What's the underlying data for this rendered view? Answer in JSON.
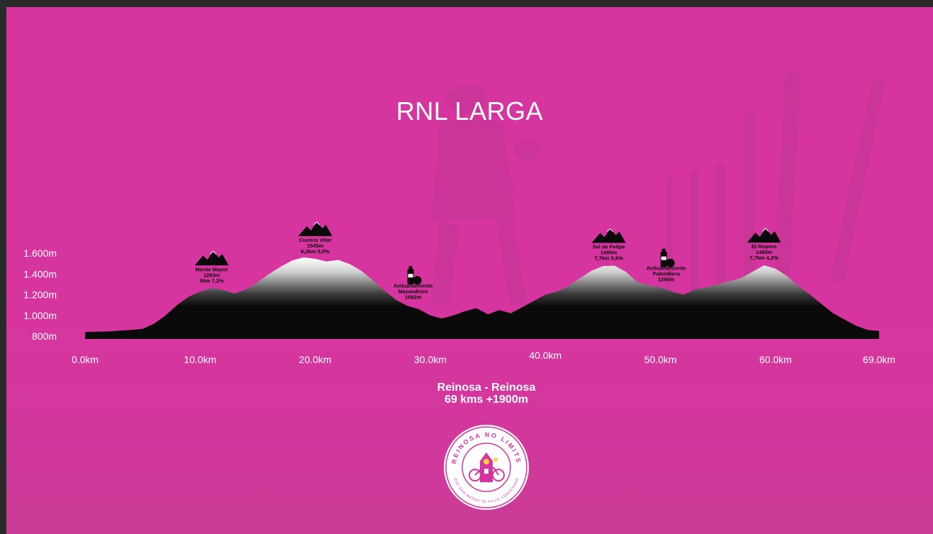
{
  "title": "RNL LARGA",
  "route": {
    "line1": "Reinosa - Reinosa",
    "line2": "69 kms +1900m"
  },
  "logo": {
    "top_text": "REINOSA NO LIMITS",
    "bottom_text": "QUE SAN MATEO TE PILLE CONFESADO"
  },
  "colors": {
    "background": "#d6359f",
    "profile": "#0a0a0a",
    "text": "#ffffff"
  },
  "chart_data": {
    "type": "area",
    "title": "RNL LARGA",
    "xlabel": "",
    "ylabel": "",
    "x_unit": "km",
    "y_unit": "m",
    "xlim": [
      0,
      69
    ],
    "ylim": [
      800,
      1600
    ],
    "x_ticks": [
      {
        "value": 0,
        "label": "0.0km"
      },
      {
        "value": 10,
        "label": "10.0km"
      },
      {
        "value": 20,
        "label": "20.0km"
      },
      {
        "value": 30,
        "label": "30.0km"
      },
      {
        "value": 40,
        "label": "40.0km"
      },
      {
        "value": 50,
        "label": "50.0km"
      },
      {
        "value": 60,
        "label": "60.0km"
      },
      {
        "value": 69,
        "label": "69.0km"
      }
    ],
    "y_ticks": [
      {
        "value": 800,
        "label": "800m"
      },
      {
        "value": 1000,
        "label": "1.000m"
      },
      {
        "value": 1200,
        "label": "1.200m"
      },
      {
        "value": 1400,
        "label": "1.400m"
      },
      {
        "value": 1600,
        "label": "1.600m"
      }
    ],
    "grid": false,
    "legend": "none",
    "profile": [
      [
        0,
        840
      ],
      [
        2,
        845
      ],
      [
        4,
        860
      ],
      [
        5,
        870
      ],
      [
        6,
        920
      ],
      [
        7,
        1000
      ],
      [
        8,
        1100
      ],
      [
        9,
        1180
      ],
      [
        10,
        1230
      ],
      [
        11,
        1263
      ],
      [
        12,
        1245
      ],
      [
        13,
        1210
      ],
      [
        14,
        1250
      ],
      [
        15,
        1320
      ],
      [
        16,
        1400
      ],
      [
        17,
        1470
      ],
      [
        18,
        1530
      ],
      [
        19,
        1560
      ],
      [
        20,
        1545
      ],
      [
        21,
        1520
      ],
      [
        22,
        1535
      ],
      [
        23,
        1495
      ],
      [
        24,
        1430
      ],
      [
        25,
        1340
      ],
      [
        26,
        1240
      ],
      [
        27,
        1150
      ],
      [
        28,
        1092
      ],
      [
        29,
        1060
      ],
      [
        30,
        1000
      ],
      [
        31,
        970
      ],
      [
        32,
        1000
      ],
      [
        33,
        1040
      ],
      [
        34,
        1070
      ],
      [
        35,
        1010
      ],
      [
        36,
        1050
      ],
      [
        37,
        1020
      ],
      [
        38,
        1080
      ],
      [
        39,
        1140
      ],
      [
        40,
        1200
      ],
      [
        41,
        1230
      ],
      [
        42,
        1280
      ],
      [
        43,
        1360
      ],
      [
        44,
        1430
      ],
      [
        45,
        1475
      ],
      [
        46,
        1480
      ],
      [
        47,
        1420
      ],
      [
        48,
        1320
      ],
      [
        49,
        1290
      ],
      [
        50,
        1270
      ],
      [
        51,
        1230
      ],
      [
        52,
        1200
      ],
      [
        53,
        1250
      ],
      [
        54,
        1270
      ],
      [
        55,
        1300
      ],
      [
        56,
        1330
      ],
      [
        57,
        1360
      ],
      [
        58,
        1420
      ],
      [
        59,
        1483
      ],
      [
        60,
        1450
      ],
      [
        61,
        1380
      ],
      [
        62,
        1280
      ],
      [
        63,
        1200
      ],
      [
        64,
        1110
      ],
      [
        65,
        1020
      ],
      [
        66,
        960
      ],
      [
        67,
        900
      ],
      [
        68,
        860
      ],
      [
        69,
        850
      ]
    ],
    "annotations": [
      {
        "icon": "mountain-icon",
        "x": 11,
        "elevation": 1263,
        "lines": [
          "Monte Mayor",
          "1263m",
          "5km 7,2%"
        ]
      },
      {
        "icon": "mountain-icon",
        "x": 20,
        "elevation": 1545,
        "lines": [
          "Cuenca Vitor",
          "1545m",
          "6,2km 5,5%"
        ]
      },
      {
        "icon": "bottle-apple-icon",
        "x": 28.5,
        "elevation": 1092,
        "lines": [
          "Avituallamiento",
          "Mazandrero",
          "1092m"
        ]
      },
      {
        "icon": "mountain-icon",
        "x": 45.5,
        "elevation": 1480,
        "lines": [
          "Sel de Felipe",
          "1480m",
          "7,7km 5,6%"
        ]
      },
      {
        "icon": "bottle-apple-icon",
        "x": 50.5,
        "elevation": 1260,
        "lines": [
          "Avituallamiento",
          "Palombera",
          "1260m"
        ]
      },
      {
        "icon": "mountain-icon",
        "x": 59,
        "elevation": 1483,
        "lines": [
          "El Ropero",
          "1483m",
          "7,7km 4,2%"
        ]
      }
    ]
  }
}
